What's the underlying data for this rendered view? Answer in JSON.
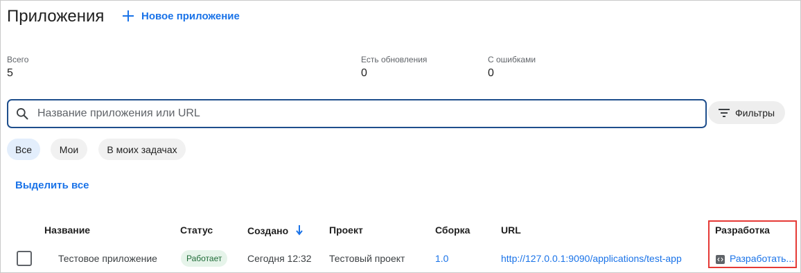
{
  "header": {
    "title": "Приложения",
    "new_app_label": "Новое приложение"
  },
  "stats": [
    {
      "label": "Всего",
      "value": "5"
    },
    {
      "label": "Есть обновления",
      "value": "0"
    },
    {
      "label": "С ошибками",
      "value": "0"
    }
  ],
  "search": {
    "placeholder": "Название приложения или URL",
    "value": ""
  },
  "filters_label": "Фильтры",
  "chips": [
    {
      "label": "Все",
      "active": true
    },
    {
      "label": "Мои",
      "active": false
    },
    {
      "label": "В моих задачах",
      "active": false
    }
  ],
  "select_all_label": "Выделить все",
  "table": {
    "columns": [
      "Название",
      "Статус",
      "Создано",
      "Проект",
      "Сборка",
      "URL",
      "Разработка"
    ],
    "rows": [
      {
        "name": "Тестовое приложение",
        "status": "Работает",
        "created": "Сегодня 12:32",
        "project": "Тестовый проект",
        "build": "1.0",
        "url": "http://127.0.0.1:9090/applications/test-app",
        "dev": "Разработать..."
      }
    ]
  },
  "colors": {
    "accent": "#1a73e8",
    "highlight": "#e53935",
    "status_bg": "#e6f4ea",
    "status_fg": "#1e6b37",
    "search_border": "#1e4e8c"
  },
  "icons": {
    "new_app": "plus-icon",
    "search": "search-icon",
    "filters": "filter-lines-icon",
    "sort": "arrow-down-icon",
    "dev": "code-icon"
  }
}
